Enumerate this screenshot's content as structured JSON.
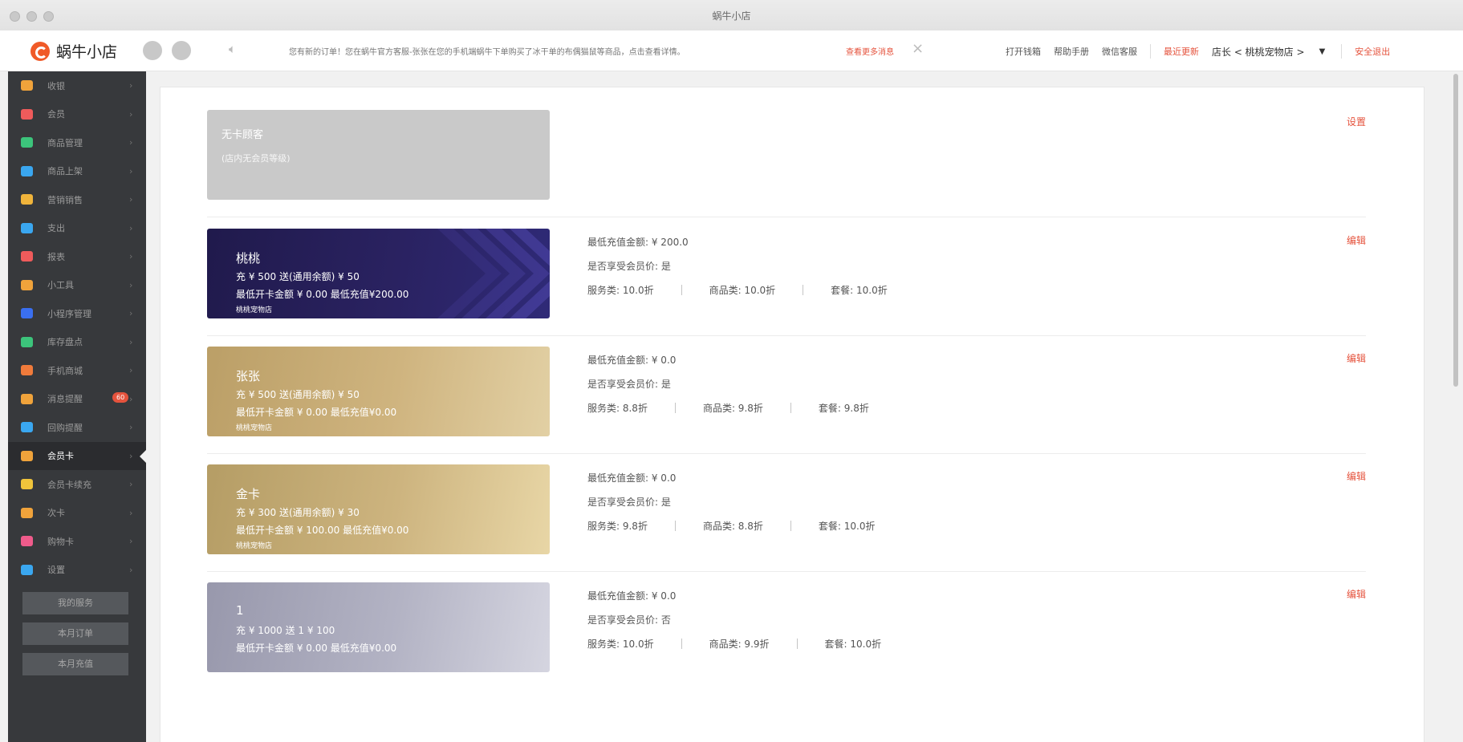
{
  "window": {
    "title": "蜗牛小店"
  },
  "header": {
    "brand": "蜗牛小店",
    "notice": "您有新的订单！您在蜗牛官方客服-张张在您的手机端蜗牛下单购买了冰干单的布偶猫鼠等商品，点击查看详情。",
    "notice_more": "查看更多消息",
    "links": [
      "打开钱箱",
      "帮助手册",
      "微信客服"
    ],
    "recent_update": "最近更新",
    "store": "店长 < 桃桃宠物店 >",
    "logout": "安全退出"
  },
  "sidebar": {
    "items": [
      {
        "label": "收银",
        "color": "#f0a33b"
      },
      {
        "label": "会员",
        "color": "#ef5b5b"
      },
      {
        "label": "商品管理",
        "color": "#3cc47b"
      },
      {
        "label": "商品上架",
        "color": "#3aa7f0"
      },
      {
        "label": "营销销售",
        "color": "#f0b43b"
      },
      {
        "label": "支出",
        "color": "#3aa7f0"
      },
      {
        "label": "报表",
        "color": "#ef5b5b"
      },
      {
        "label": "小工具",
        "color": "#f0a33b"
      },
      {
        "label": "小程序管理",
        "color": "#3a6ff0"
      },
      {
        "label": "库存盘点",
        "color": "#3cc47b"
      },
      {
        "label": "手机商城",
        "color": "#f07b3b"
      },
      {
        "label": "消息提醒",
        "color": "#f0a33b",
        "badge": "60"
      },
      {
        "label": "回购提醒",
        "color": "#3aa7f0"
      },
      {
        "label": "会员卡",
        "color": "#f0a33b",
        "active": true
      },
      {
        "label": "会员卡续充",
        "color": "#f0c43b"
      },
      {
        "label": "次卡",
        "color": "#f0a33b"
      },
      {
        "label": "购物卡",
        "color": "#ef5b8b"
      },
      {
        "label": "设置",
        "color": "#3aa7f0"
      }
    ],
    "buttons": [
      "我的服务",
      "本月订单",
      "本月充值"
    ]
  },
  "cards": [
    {
      "style": "none",
      "name": "无卡顾客",
      "sub": "(店内无会员等级)",
      "action": "设置"
    },
    {
      "style": "purple",
      "name": "桃桃",
      "line1": "充 ¥ 500 送(通用余额) ¥ 50",
      "line2": "最低开卡金额 ¥ 0.00 最低充值¥200.00",
      "line3": "桃桃宠物店",
      "min_recharge": "最低充值金额: ¥ 200.0",
      "member_price": "是否享受会员价:  是",
      "service": "服务类:  10.0折",
      "goods": "商品类:  10.0折",
      "package": "套餐:  10.0折",
      "action": "编辑"
    },
    {
      "style": "gold1",
      "name": "张张",
      "line1": "充 ¥ 500 送(通用余额) ¥ 50",
      "line2": "最低开卡金额 ¥ 0.00 最低充值¥0.00",
      "line3": "桃桃宠物店",
      "min_recharge": "最低充值金额: ¥ 0.0",
      "member_price": "是否享受会员价:  是",
      "service": "服务类:  8.8折",
      "goods": "商品类:  9.8折",
      "package": "套餐:  9.8折",
      "action": "编辑"
    },
    {
      "style": "gold2",
      "name": "金卡",
      "line1": "充 ¥ 300 送(通用余额) ¥ 30",
      "line2": "最低开卡金额 ¥ 100.00 最低充值¥0.00",
      "line3": "桃桃宠物店",
      "min_recharge": "最低充值金额: ¥ 0.0",
      "member_price": "是否享受会员价:  是",
      "service": "服务类:  9.8折",
      "goods": "商品类:  8.8折",
      "package": "套餐:  10.0折",
      "action": "编辑"
    },
    {
      "style": "silver",
      "name": "1",
      "line1": "充 ¥ 1000 送 1 ¥ 100",
      "line2": "最低开卡金额 ¥ 0.00 最低充值¥0.00",
      "line3": "",
      "min_recharge": "最低充值金额: ¥ 0.0",
      "member_price": "是否享受会员价:  否",
      "service": "服务类:  10.0折",
      "goods": "商品类:  9.9折",
      "package": "套餐:  10.0折",
      "action": "编辑"
    }
  ]
}
